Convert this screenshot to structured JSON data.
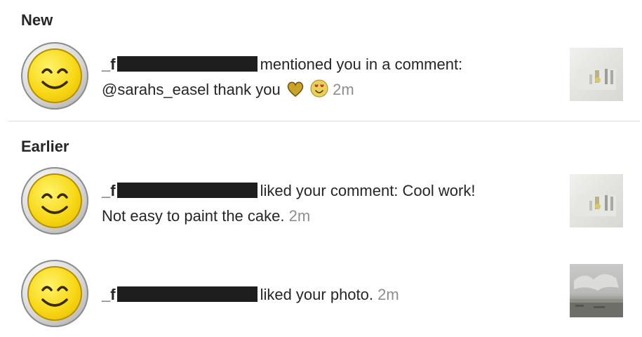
{
  "sections": {
    "new": "New",
    "earlier": "Earlier"
  },
  "notifications": [
    {
      "username_visible": "_f",
      "line1": "mentioned you in a comment:",
      "mention": "@sarahs_easel thank you",
      "time": "2m",
      "emojis": [
        "yellow-heart-emoji",
        "heart-eyes-emoji"
      ],
      "thumbnail": "cake-painting-thumbnail"
    },
    {
      "username_visible": "_f",
      "line1": "liked your comment: Cool work!",
      "line2": "Not easy to paint the cake.",
      "time": "2m",
      "thumbnail": "cake-painting-thumbnail"
    },
    {
      "username_visible": "_f",
      "line1": "liked your photo.",
      "time": "2m",
      "thumbnail": "landscape-photo-thumbnail"
    }
  ],
  "colors": {
    "text": "#262626",
    "muted": "#8e8e8e",
    "divider": "#dbdbdb",
    "redaction": "#1e1e1e",
    "avatar_yellow": "#f7d715"
  }
}
